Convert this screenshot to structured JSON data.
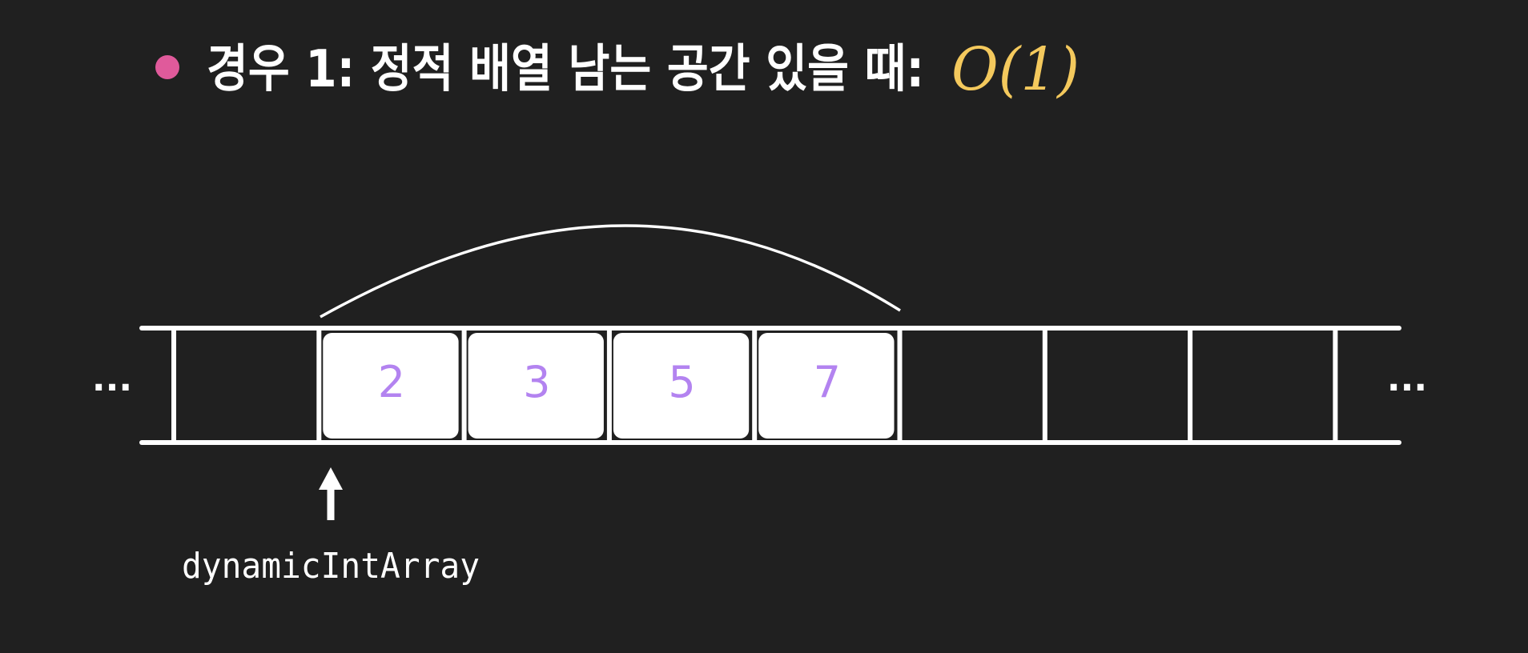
{
  "slide": {
    "heading": "경우 1: 정적 배열 남는 공간 있을 때:",
    "complexity": "O(1)",
    "bullet_color": "#e05a9b",
    "complexity_color": "#f4c95d",
    "background_color": "#202020"
  },
  "array": {
    "left_ellipsis": "...",
    "right_ellipsis": "...",
    "cells": [
      "",
      "2",
      "3",
      "5",
      "7",
      "",
      "",
      ""
    ],
    "value_color": "#b383f0",
    "pointer_label": "dynamicIntArray"
  }
}
